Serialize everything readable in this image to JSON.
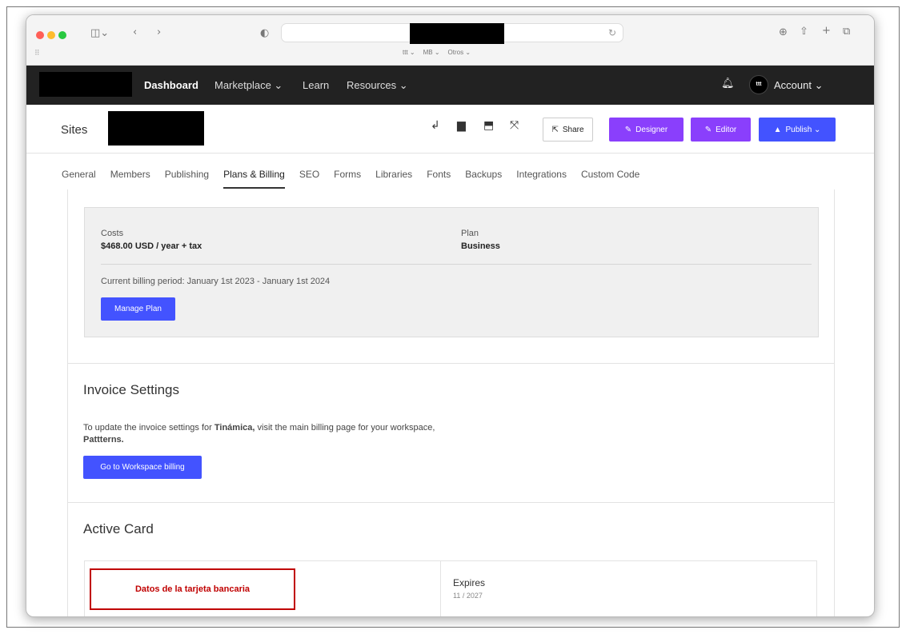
{
  "browser": {
    "favorites": [
      "ttt ⌄",
      "MB ⌄",
      "Otros ⌄"
    ]
  },
  "topnav": {
    "items": [
      "Dashboard",
      "Marketplace ⌄",
      "Learn",
      "Resources ⌄"
    ],
    "avatar_initials": "ttt",
    "account_label": "Account ⌄"
  },
  "sitesbar": {
    "title": "Sites",
    "share_label": "Share",
    "designer_label": "Designer",
    "editor_label": "Editor",
    "publish_label": "Publish ⌄"
  },
  "tabs": [
    "General",
    "Members",
    "Publishing",
    "Plans & Billing",
    "SEO",
    "Forms",
    "Libraries",
    "Fonts",
    "Backups",
    "Integrations",
    "Custom Code"
  ],
  "active_tab": "Plans & Billing",
  "plan": {
    "costs_label": "Costs",
    "costs_value": "$468.00 USD / year + tax",
    "plan_label": "Plan",
    "plan_value": "Business",
    "billing_period": "Current billing period: January 1st 2023 - January 1st 2024",
    "manage_label": "Manage Plan"
  },
  "invoice": {
    "title": "Invoice Settings",
    "text_before": "To update the invoice settings for ",
    "site_name": "Tinámica,",
    "text_after": " visit the main billing page for your workspace,",
    "workspace": "Pattterns.",
    "button_label": "Go to Workspace billing"
  },
  "card": {
    "title": "Active Card",
    "annotation": "Datos de la tarjeta bancaria",
    "expires_label": "Expires",
    "expires_value": "11 / 2027"
  }
}
